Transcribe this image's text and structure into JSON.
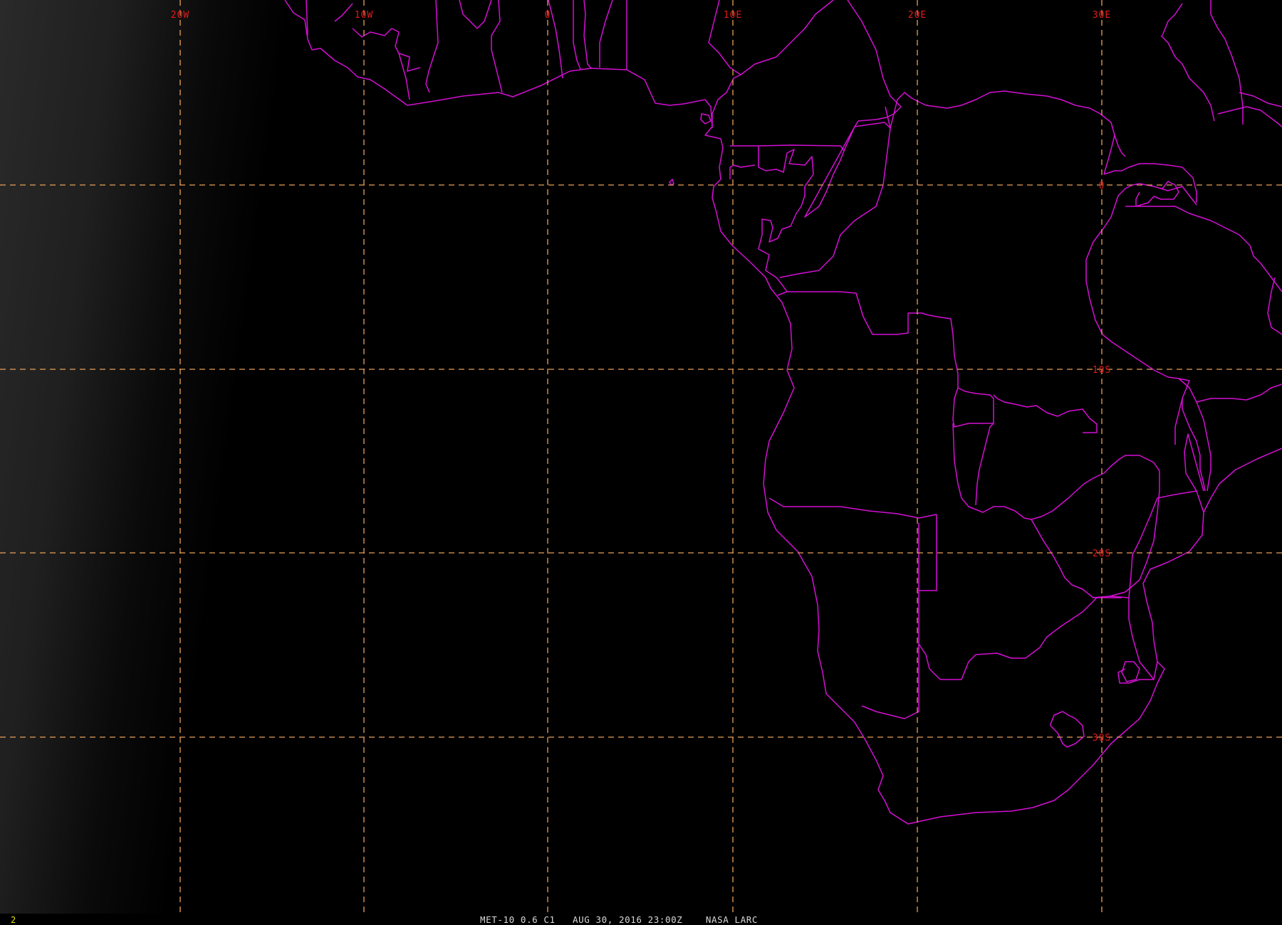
{
  "image": {
    "frame_number": "2",
    "caption": "MET-10 0.6 C1   AUG 30, 2016 23:00Z    NASA LARC"
  },
  "grid": {
    "line_color": "#e8a05a",
    "label_color": "#e51a1a",
    "meridian_labels": [
      "20W",
      "10W",
      "0",
      "10E",
      "20E",
      "30E"
    ],
    "parallel_labels": [
      "0",
      "10S",
      "20S",
      "30S"
    ]
  },
  "boundaries": {
    "color": "#d40fd4"
  }
}
